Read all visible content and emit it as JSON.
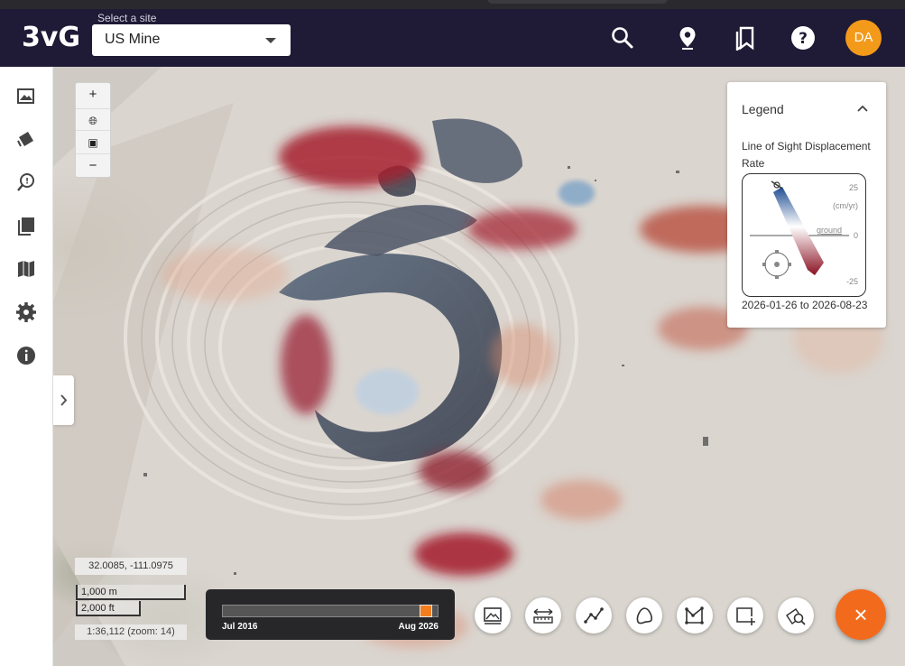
{
  "header": {
    "logo": "3vG",
    "site_label": "Select a site",
    "site_value": "US Mine",
    "avatar_initials": "DA",
    "icons": [
      "search-icon",
      "map-pin-icon",
      "bookmarks-icon",
      "help-icon"
    ]
  },
  "sidebar": {
    "items": [
      "imagery-icon",
      "layers-icon",
      "search-location-icon",
      "collections-icon",
      "map-icon",
      "settings-icon",
      "info-icon"
    ]
  },
  "map_controls": {
    "zoom_in": "+",
    "zoom_out": "−",
    "globe_icon": "globe-icon",
    "basemap_icon": "basemap-icon"
  },
  "legend": {
    "title": "Legend",
    "subtitle": "Line of Sight Displacement Rate",
    "scale_top": "25",
    "scale_unit": "(cm/yr)",
    "scale_ground": "ground",
    "scale_mid": "0",
    "scale_bottom": "-25",
    "date_range": "2026-01-26 to 2026-08-23"
  },
  "scale": {
    "coords": "32.0085, -111.0975",
    "metric": "1,000 m",
    "imperial": "2,000 ft",
    "zoom_readout": "1:36,112 (zoom: 14)"
  },
  "timeline": {
    "start_label": "Jul 2016",
    "end_label": "Aug 2026",
    "position": 0.97
  },
  "tools": [
    "image-compare-icon",
    "measure-icon",
    "line-profile-icon",
    "polygon-icon",
    "area-icon",
    "add-region-icon",
    "inspect-icon"
  ],
  "fab_label": "×",
  "colors": {
    "header_bg": "#1f1b36",
    "accent_orange": "#f26b1d",
    "avatar_bg": "#f39a1a",
    "subsidence_red": "#9e1b2a",
    "uplift_blue": "#3a6ea8"
  }
}
